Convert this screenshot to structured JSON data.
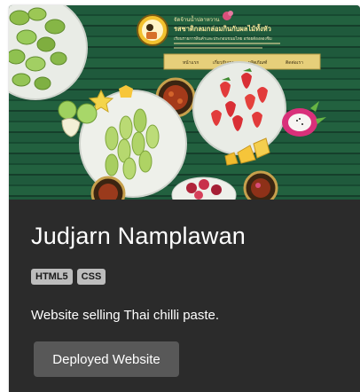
{
  "card": {
    "title": "Judjarn Namplawan",
    "tags": [
      "HTML5",
      "CSS"
    ],
    "description": "Website selling Thai chilli paste.",
    "button_label": "Deployed Website"
  },
  "preview": {
    "site_title_line1": "จัดจ้านน้ำปลาหวาน",
    "site_title_line2": "รสชาติกลมกล่อมกินกับผลไม้ทั้งหัว",
    "site_blurb": "เรียนรายการสินค้าและประกอบขนมไทย อร่อยต้องลองชิม",
    "nav_items": [
      "หน้าแรก",
      "เกี่ยวกับเรา",
      "ผลิตภัณฑ์",
      "ติดต่อเรา"
    ],
    "icon": "thai-dessert-website-screenshot"
  },
  "colors": {
    "card_bg": "#2b2b2b",
    "tag_bg": "#bdbdbd",
    "button_bg": "#585858",
    "text": "#ffffff"
  }
}
